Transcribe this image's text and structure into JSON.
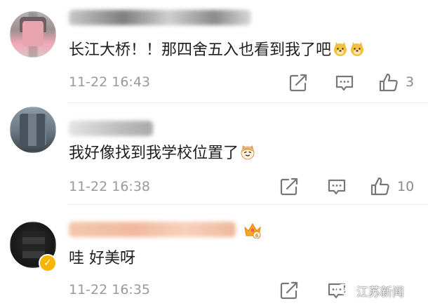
{
  "comments": [
    {
      "text": "长江大桥！！那四舍五入也看到我了吧",
      "timestamp": "11-22 16:43",
      "likes": "3",
      "emojis": [
        "doge-icon",
        "doge-icon"
      ]
    },
    {
      "text": "我好像找到我学校位置了",
      "timestamp": "11-22 16:38",
      "likes": "10",
      "emojis": [
        "cat-icon"
      ]
    },
    {
      "text": "哇 好美呀",
      "timestamp": "11-22 16:35",
      "likes": "",
      "verified": true,
      "vip_level": "6"
    }
  ],
  "watermark": {
    "text": "江苏新闻"
  },
  "colors": {
    "text": "#1f1f1f",
    "meta": "#9a9a9a",
    "icon": "#777777",
    "verified": "#f7b500",
    "vip": "#f5a623"
  }
}
